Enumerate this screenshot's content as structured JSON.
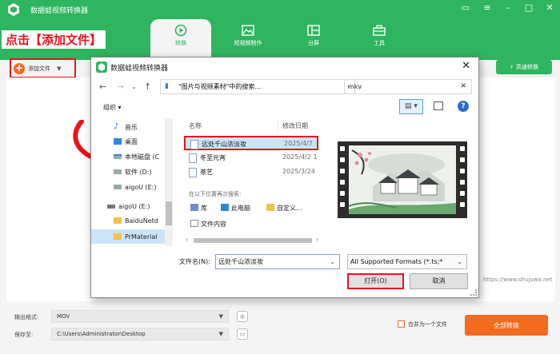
{
  "app": {
    "title": "数据蛙视频转换器",
    "brand_color": "#2fb55f",
    "accent_color": "#f26b21"
  },
  "nav_tabs": [
    {
      "label": "转换",
      "icon": "refresh-play-icon",
      "active": true
    },
    {
      "label": "短视频制作",
      "icon": "image-icon",
      "active": false
    },
    {
      "label": "分屏",
      "icon": "split-screen-icon",
      "active": false
    },
    {
      "label": "工具",
      "icon": "toolbox-icon",
      "active": false
    }
  ],
  "annotation": "点击【添加文件】",
  "toolbar": {
    "add_file_label": "添加文件",
    "fast_convert_label": "高速转换"
  },
  "bottom": {
    "output_format_label": "输出格式:",
    "output_format_value": "MOV",
    "save_to_label": "保存至:",
    "save_to_value": "C:\\Users\\Administrator\\Desktop",
    "merge_label": "合并为一个文件",
    "convert_all_label": "全部转换"
  },
  "watermark": "https://www.shujuwa.net",
  "dialog": {
    "title": "数据蛙视频转换器",
    "address": "\"图片与视频素材\"中的搜索...",
    "search_value": "mkv",
    "organize_label": "组织 ▾",
    "tree_items": [
      {
        "label": "音乐",
        "icon": "music-icon"
      },
      {
        "label": "桌面",
        "icon": "desktop-icon"
      },
      {
        "label": "本地磁盘 (C",
        "icon": "drive-icon"
      },
      {
        "label": "软件 (D:)",
        "icon": "drive-icon"
      },
      {
        "label": "aigoU (E:)",
        "icon": "drive-icon"
      },
      {
        "label": "aigoU (E:)",
        "icon": "usb-icon"
      },
      {
        "label": "BaiduNetd",
        "icon": "folder-icon"
      },
      {
        "label": "PrMaterial",
        "icon": "folder-icon"
      }
    ],
    "col_name": "名称",
    "col_date": "修改日期",
    "files": [
      {
        "name": "远处千山浓淡妆",
        "date": "2025/4/7",
        "selected": true
      },
      {
        "name": "冬至元宵",
        "date": "2025/4/2 1",
        "selected": false
      },
      {
        "name": "茶艺",
        "date": "2025/3/24",
        "selected": false
      }
    ],
    "search_again": "在以下位置再次搜索:",
    "locations": [
      {
        "label": "库",
        "icon": "library-icon"
      },
      {
        "label": "此电脑",
        "icon": "computer-icon"
      },
      {
        "label": "自定义...",
        "icon": "folder-icon"
      },
      {
        "label": "文件内容",
        "icon": "document-icon"
      }
    ],
    "filename_label": "文件名(N):",
    "filename_value": "远处千山浓淡妆",
    "filter_value": "All Supported Formats (*.ts;*",
    "open_label": "打开(O)",
    "cancel_label": "取消"
  }
}
